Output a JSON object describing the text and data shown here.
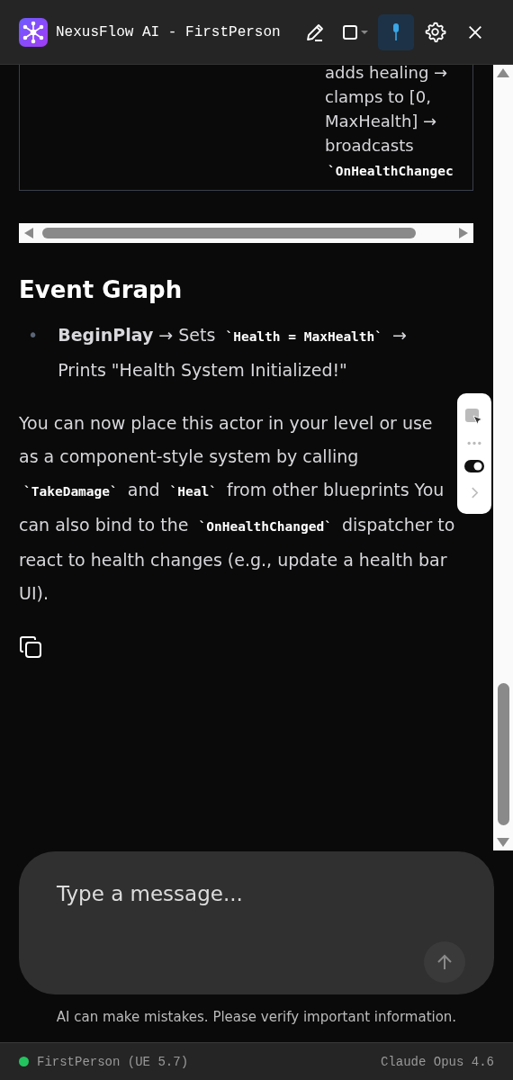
{
  "window": {
    "title": "NexusFlow AI - FirstPerson"
  },
  "toolbar": {
    "pin_active": true
  },
  "table_cell": {
    "text": "adds healing → clamps to [0, MaxHealth] → broadcasts",
    "code": "`OnHealthChangec"
  },
  "heading": "Event Graph",
  "bullets": [
    {
      "marker": "•",
      "segments": [
        {
          "kind": "bold",
          "text": "BeginPlay"
        },
        {
          "kind": "text",
          "text": " → Sets "
        },
        {
          "kind": "code",
          "text": "`Health = MaxHealth`"
        },
        {
          "kind": "text",
          "text": " → Prints \"Health System Initialized!\""
        }
      ]
    }
  ],
  "paragraph": {
    "segments": [
      {
        "kind": "text",
        "text": "You can now place this actor in your level or use as a component-style system by calling "
      },
      {
        "kind": "code",
        "text": "`TakeDamage`"
      },
      {
        "kind": "text",
        "text": " and "
      },
      {
        "kind": "code",
        "text": "`Heal`"
      },
      {
        "kind": "text",
        "text": " from other blueprints"
      },
      {
        "kind": "text",
        "text": " You can also bind to the "
      },
      {
        "kind": "code",
        "text": "`OnHealthChanged`"
      },
      {
        "kind": "text",
        "text": " dispatcher to react to health changes (e.g., update a health bar UI)."
      }
    ]
  },
  "floating_toolbar": {
    "toggle_on": true
  },
  "composer": {
    "placeholder": "Type a message..."
  },
  "disclaimer": "AI can make mistakes. Please verify important information.",
  "status_bar": {
    "connected": true,
    "project": "FirstPerson (UE 5.7)",
    "model": "Claude Opus 4.6"
  }
}
